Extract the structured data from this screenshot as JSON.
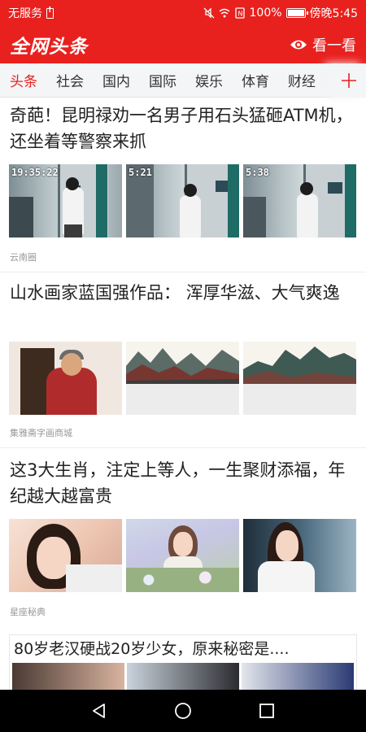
{
  "status_bar": {
    "carrier": "无服务",
    "battery": "100%",
    "time": "傍晚5:45",
    "icons": [
      "sim-icon",
      "mute-icon",
      "wifi-icon",
      "nfc-icon",
      "battery-icon"
    ]
  },
  "header": {
    "logo": "全网头条",
    "watch_label": "看一看",
    "brand_color": "#e8211e"
  },
  "tabs": {
    "items": [
      "头条",
      "社会",
      "国内",
      "国际",
      "娱乐",
      "体育",
      "财经"
    ],
    "active_index": 0,
    "add_icon": "plus-icon"
  },
  "articles": [
    {
      "title": "奇葩！昆明禄劝一名男子用石头猛砸ATM机，还坐着等警察来抓",
      "source": "云南圈",
      "thumb_timestamps": [
        "19:35:22",
        "5:21",
        "5:38"
      ]
    },
    {
      "title": "山水画家蓝国强作品： 浑厚华滋、大气爽逸",
      "source": "集雅斋字画商城"
    },
    {
      "title": "这3大生肖，注定上等人，一生聚财添福，年纪越大越富贵",
      "source": "星座秘典"
    },
    {
      "title": "80岁老汉硬战20岁少女，原来秘密是...."
    }
  ],
  "nav": {
    "icons": [
      "back-icon",
      "home-icon",
      "recent-apps-icon"
    ]
  }
}
